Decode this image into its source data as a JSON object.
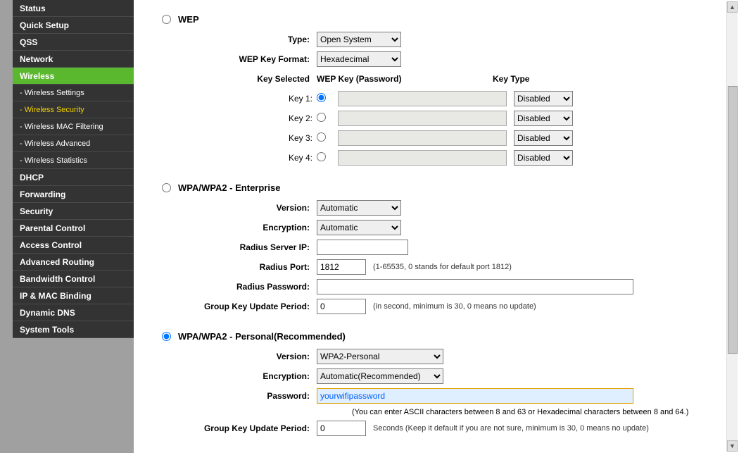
{
  "nav": {
    "items": [
      "Status",
      "Quick Setup",
      "QSS",
      "Network",
      "Wireless",
      "DHCP",
      "Forwarding",
      "Security",
      "Parental Control",
      "Access Control",
      "Advanced Routing",
      "Bandwidth Control",
      "IP & MAC Binding",
      "Dynamic DNS",
      "System Tools"
    ],
    "wireless_subs": [
      "- Wireless Settings",
      "- Wireless Security",
      "- Wireless MAC Filtering",
      "- Wireless Advanced",
      "- Wireless Statistics"
    ],
    "active": "Wireless",
    "active_sub": "- Wireless Security"
  },
  "wep": {
    "title": "WEP",
    "type_label": "Type:",
    "type_value": "Open System",
    "format_label": "WEP Key Format:",
    "format_value": "Hexadecimal",
    "key_selected_label": "Key Selected",
    "wep_key_header": "WEP Key (Password)",
    "key_type_header": "Key Type",
    "keys": [
      {
        "label": "Key 1:",
        "value": "",
        "type": "Disabled",
        "checked": true
      },
      {
        "label": "Key 2:",
        "value": "",
        "type": "Disabled",
        "checked": false
      },
      {
        "label": "Key 3:",
        "value": "",
        "type": "Disabled",
        "checked": false
      },
      {
        "label": "Key 4:",
        "value": "",
        "type": "Disabled",
        "checked": false
      }
    ]
  },
  "ent": {
    "title": "WPA/WPA2 - Enterprise",
    "version_label": "Version:",
    "version_value": "Automatic",
    "encryption_label": "Encryption:",
    "encryption_value": "Automatic",
    "radius_ip_label": "Radius Server IP:",
    "radius_ip_value": "",
    "radius_port_label": "Radius Port:",
    "radius_port_value": "1812",
    "radius_port_hint": "(1-65535, 0 stands for default port 1812)",
    "radius_pw_label": "Radius Password:",
    "radius_pw_value": "",
    "gkup_label": "Group Key Update Period:",
    "gkup_value": "0",
    "gkup_hint": "(in second, minimum is 30, 0 means no update)"
  },
  "per": {
    "title": "WPA/WPA2 - Personal(Recommended)",
    "version_label": "Version:",
    "version_value": "WPA2-Personal",
    "encryption_label": "Encryption:",
    "encryption_value": "Automatic(Recommended)",
    "password_label": "Password:",
    "password_value": "yourwifipassword",
    "password_hint": "(You can enter ASCII characters between 8 and 63 or Hexadecimal characters between 8 and 64.)",
    "gkup_label": "Group Key Update Period:",
    "gkup_value": "0",
    "gkup_hint": "Seconds (Keep it default if you are not sure, minimum is 30, 0 means no update)"
  },
  "selected_mode": "personal"
}
